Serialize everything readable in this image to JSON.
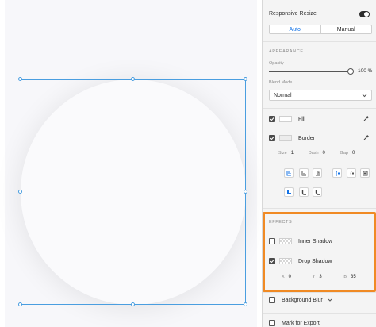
{
  "canvas": {
    "shape": "ellipse",
    "selected": true
  },
  "panel": {
    "responsive_resize": {
      "label": "Responsive Resize",
      "enabled": true,
      "modes": [
        "Auto",
        "Manual"
      ],
      "active_mode": "Auto"
    },
    "appearance": {
      "heading": "APPEARANCE",
      "opacity_label": "Opacity",
      "opacity_value": "100 %",
      "opacity_fraction": 1.0,
      "blend_label": "Blend Mode",
      "blend_value": "Normal",
      "fill_label": "Fill",
      "border_label": "Border",
      "size_label": "Size",
      "size_value": "1",
      "dash_label": "Dash",
      "dash_value": "0",
      "gap_label": "Gap",
      "gap_value": "0"
    },
    "effects": {
      "heading": "EFFECTS",
      "inner_shadow_label": "Inner Shadow",
      "drop_shadow_label": "Drop Shadow",
      "x_label": "X",
      "x_value": "0",
      "y_label": "Y",
      "y_value": "3",
      "b_label": "B",
      "b_value": "35",
      "background_blur_label": "Background Blur",
      "mark_export_label": "Mark for Export"
    }
  },
  "colors": {
    "highlight": "#f08a24",
    "accent": "#1473e6",
    "selection": "#4a9ee0"
  }
}
